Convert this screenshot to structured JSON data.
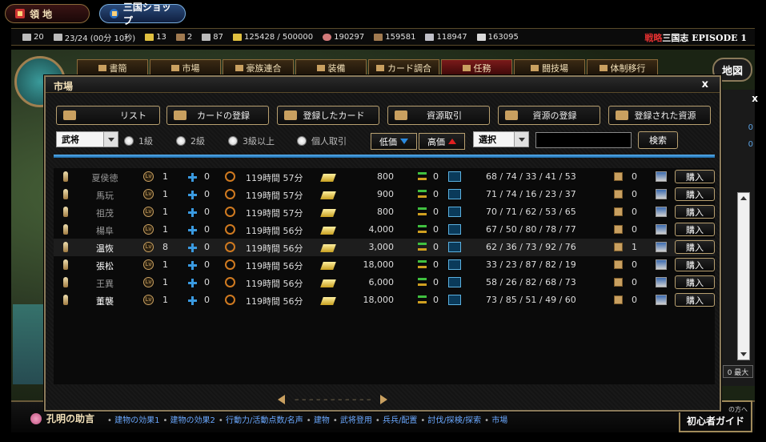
{
  "top": {
    "ryochi": "領 地",
    "shop": "三国ショップ"
  },
  "resources": [
    {
      "icon": "card-icon",
      "value": "20"
    },
    {
      "icon": "soldier-icon",
      "value": "23/24 (00分 10秒)"
    },
    {
      "icon": "star-icon",
      "value": "13"
    },
    {
      "icon": "horse-icon",
      "value": "2"
    },
    {
      "icon": "person-icon",
      "value": "87"
    },
    {
      "icon": "gold-icon",
      "value": "125428 / 500000"
    },
    {
      "icon": "meat-icon",
      "value": "190297"
    },
    {
      "icon": "wood-icon",
      "value": "159581"
    },
    {
      "icon": "stone-icon",
      "value": "118947"
    },
    {
      "icon": "iron-icon",
      "value": "163095"
    }
  ],
  "episode": {
    "prefix": "戦略",
    "text": "三国志 EPISODE 1"
  },
  "nav_tabs": [
    "書簡",
    "市場",
    "豪族連合",
    "装備",
    "カード調合",
    "任務",
    "闘技場",
    "体制移行"
  ],
  "map_button": "地図",
  "dialog": {
    "title": "市場",
    "close": "x",
    "tabs": [
      "リスト",
      "カードの登録",
      "登録したカード",
      "資源取引",
      "資源の登録",
      "登録された資源"
    ],
    "filter_select": "武将",
    "radios": [
      "1級",
      "2級",
      "3級以上",
      "個人取引"
    ],
    "sort_low": "低価",
    "sort_high": "高価",
    "select2": "選択",
    "search_value": "",
    "search_btn": "検索",
    "buy_label": "購入",
    "rows": [
      {
        "name": "夏侯徳",
        "lv": "1",
        "plus": "0",
        "time": "119時間 57分",
        "price": "800",
        "trade": "0",
        "stats": "68 / 74 / 33 / 41 / 53",
        "box": "0"
      },
      {
        "name": "馬玩",
        "lv": "1",
        "plus": "0",
        "time": "119時間 57分",
        "price": "900",
        "trade": "0",
        "stats": "71 / 74 / 16 / 23 / 37",
        "box": "0"
      },
      {
        "name": "祖茂",
        "lv": "1",
        "plus": "0",
        "time": "119時間 57分",
        "price": "800",
        "trade": "0",
        "stats": "70 / 71 / 62 / 53 / 65",
        "box": "0"
      },
      {
        "name": "楊阜",
        "lv": "1",
        "plus": "0",
        "time": "119時間 56分",
        "price": "4,000",
        "trade": "0",
        "stats": "67 / 50 / 80 / 78 / 77",
        "box": "0"
      },
      {
        "name": "温恢",
        "lv": "8",
        "plus": "0",
        "time": "119時間 56分",
        "price": "3,000",
        "trade": "0",
        "stats": "62 / 36 / 73 / 92 / 76",
        "box": "1"
      },
      {
        "name": "張松",
        "lv": "1",
        "plus": "0",
        "time": "119時間 56分",
        "price": "18,000",
        "trade": "0",
        "stats": "33 / 23 / 87 / 82 / 19",
        "box": "0"
      },
      {
        "name": "王異",
        "lv": "1",
        "plus": "0",
        "time": "119時間 56分",
        "price": "6,000",
        "trade": "0",
        "stats": "58 / 26 / 82 / 68 / 73",
        "box": "0"
      },
      {
        "name": "董襲",
        "lv": "1",
        "plus": "0",
        "time": "119時間 56分",
        "price": "18,000",
        "trade": "0",
        "stats": "73 / 85 / 51 / 49 / 60",
        "box": "0"
      }
    ],
    "pager_dashes": "– – – – – – – – – – –"
  },
  "side": {
    "close": "x",
    "num1": "0",
    "num2": "0",
    "max": "0 最大"
  },
  "advice": {
    "title": "孔明の助言",
    "links": [
      "建物の効果1",
      "建物の効果2",
      "行動力/活動点数/名声",
      "建物",
      "武将登用",
      "兵兵/配置",
      "討伐/探検/探索",
      "市場"
    ]
  },
  "beginner": {
    "small": "の方へ",
    "label": "初心者ガイド"
  }
}
